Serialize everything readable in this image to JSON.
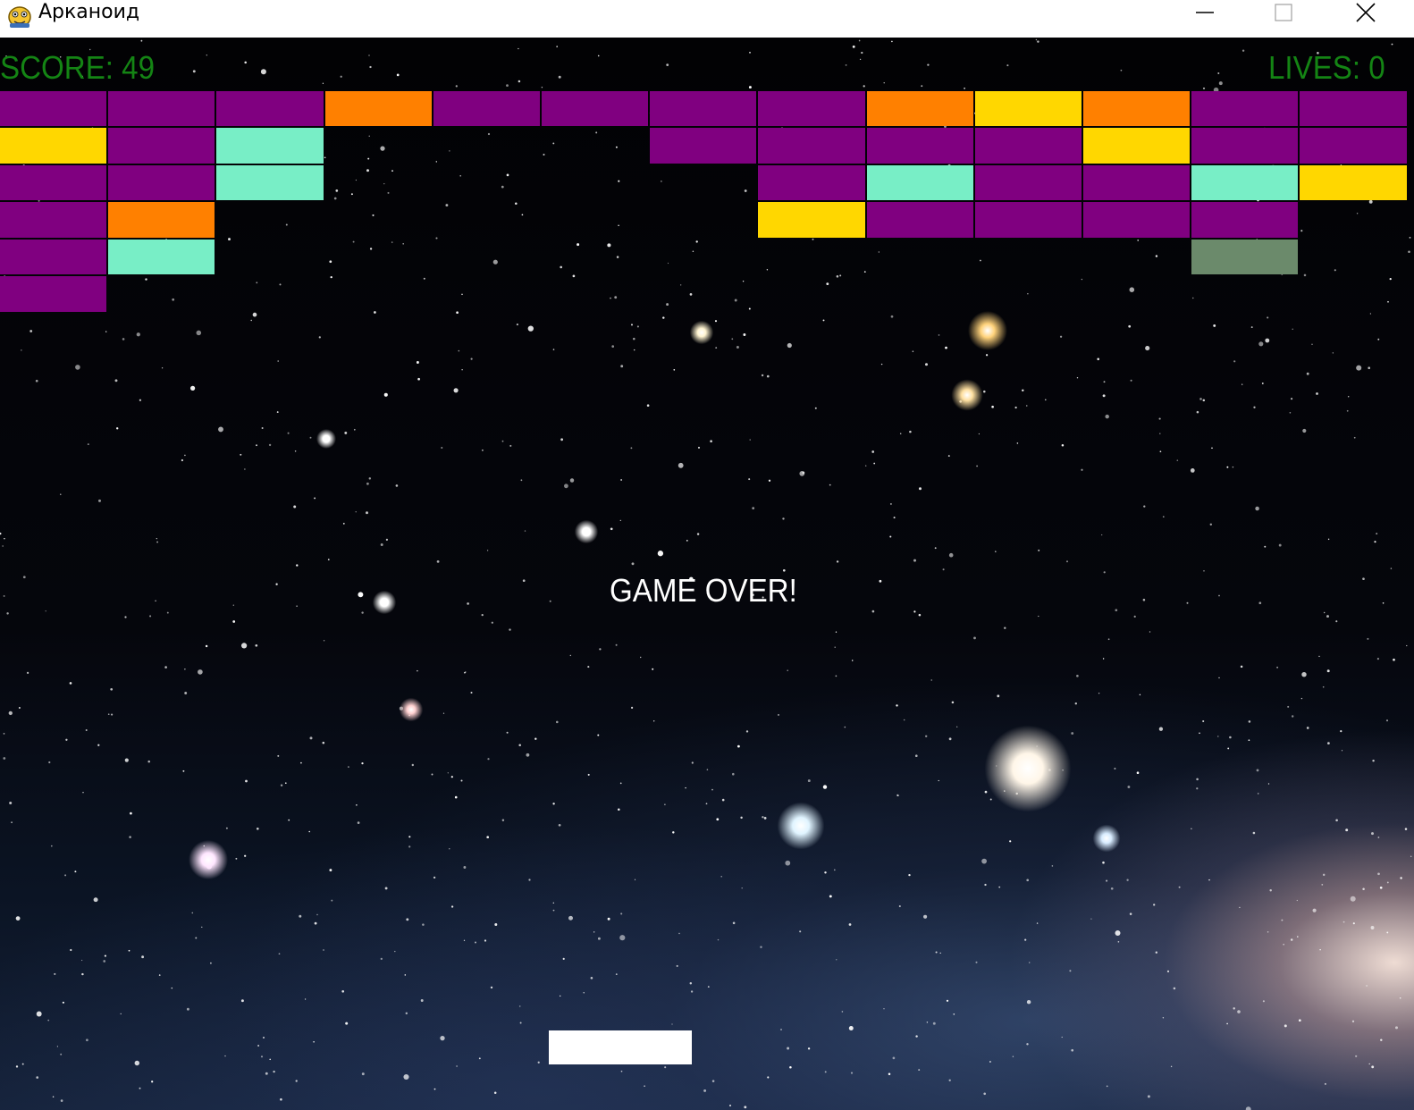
{
  "window": {
    "title": "Арканоид",
    "icon": "pygame-snake-icon",
    "controls": [
      "minimize-icon",
      "maximize-icon",
      "close-icon"
    ]
  },
  "hud": {
    "score_text": "SCORE: 49",
    "lives_text": "LIVES: 0",
    "color": "#148414"
  },
  "message": "GAME OVER!",
  "colors": {
    "purple": "#800080",
    "orange": "#ff8000",
    "yellow": "#ffd700",
    "teal": "#78eec6",
    "gray_green": "#6b8a6b",
    "paddle": "#ffffff"
  },
  "brick_grid": {
    "columns": 13,
    "rows": [
      [
        "purple",
        "purple",
        "purple",
        "orange",
        "purple",
        "purple",
        "purple",
        "purple",
        "orange",
        "yellow",
        "orange",
        "purple",
        "purple"
      ],
      [
        "yellow",
        "purple",
        "teal",
        null,
        null,
        null,
        "purple",
        "purple",
        "purple",
        "purple",
        "yellow",
        "purple",
        "purple"
      ],
      [
        "purple",
        "purple",
        "teal",
        null,
        null,
        null,
        null,
        "purple",
        "teal",
        "purple",
        "purple",
        "teal",
        "yellow"
      ],
      [
        "purple",
        "orange",
        null,
        null,
        null,
        null,
        null,
        "yellow",
        "purple",
        "purple",
        "purple",
        "purple",
        null
      ],
      [
        "purple",
        "teal",
        null,
        null,
        null,
        null,
        null,
        null,
        null,
        null,
        null,
        "gray_green",
        null
      ],
      [
        "purple",
        null,
        null,
        null,
        null,
        null,
        null,
        null,
        null,
        null,
        null,
        null,
        null
      ]
    ]
  },
  "paddle": {
    "color": "#ffffff"
  }
}
